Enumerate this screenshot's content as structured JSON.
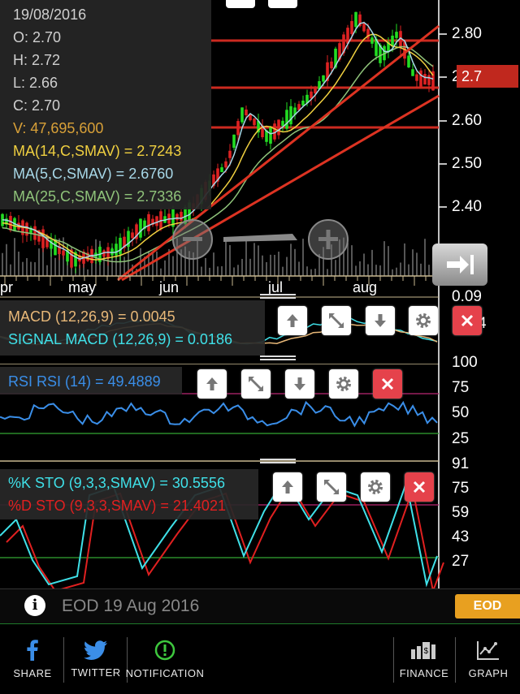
{
  "info": {
    "date": "19/08/2016",
    "open": "O: 2.70",
    "high": "H: 2.72",
    "low": "L: 2.66",
    "close": "C: 2.70",
    "volume": "V: 47,695,600",
    "ma14": "MA(14,C,SMAV) = 2.7243",
    "ma5": "MA(5,C,SMAV) = 2.6760",
    "ma25": "MA(25,C,SMAV) = 2.7336"
  },
  "price_axis": [
    "2.80",
    "2",
    "2.60",
    "2.50",
    "2.40",
    "0.09"
  ],
  "current_price": "2.7",
  "months": [
    "pr",
    "may",
    "jun",
    "jul",
    "aug"
  ],
  "macd": {
    "label": "MACD (12,26,9) = 0.0045",
    "signal": "SIGNAL MACD (12,26,9) = 0.0186",
    "axis_cut": "4"
  },
  "rsi": {
    "label": "RSI RSI (14) = 49.4889",
    "axis": [
      "100",
      "75",
      "50",
      "25"
    ]
  },
  "sto": {
    "k_label": "%K STO (9,3,3,SMAV) = 30.5556",
    "d_label": "%D STO (9,3,3,SMAV) = 21.4021",
    "axis": [
      "91",
      "75",
      "59",
      "43",
      "27"
    ]
  },
  "status": {
    "text": "EOD 19 Aug 2016",
    "badge": "EOD"
  },
  "nav": {
    "share": "SHARE",
    "twitter": "TWITTER",
    "notification": "NOTIFICATION",
    "finance": "FINANCE",
    "graph": "GRAPH"
  },
  "colors": {
    "up_candle": "#22dd22",
    "down_candle": "#dd2222",
    "ma14": "#f0d040",
    "ma5": "#a8d8e8",
    "ma25": "#8fc37a",
    "trendline": "#dd3322",
    "macd_text": "#e8b878",
    "signal_text": "#3fe0e8",
    "rsi": "#3a8ee8",
    "sto_k": "#3fe0e8",
    "sto_d": "#e02020",
    "eod_badge": "#e8a020"
  },
  "chart_data": {
    "type": "line",
    "ylim": [
      2.3,
      2.85
    ],
    "candles_visible": true,
    "indicators": [
      "MACD",
      "RSI",
      "STO"
    ]
  }
}
